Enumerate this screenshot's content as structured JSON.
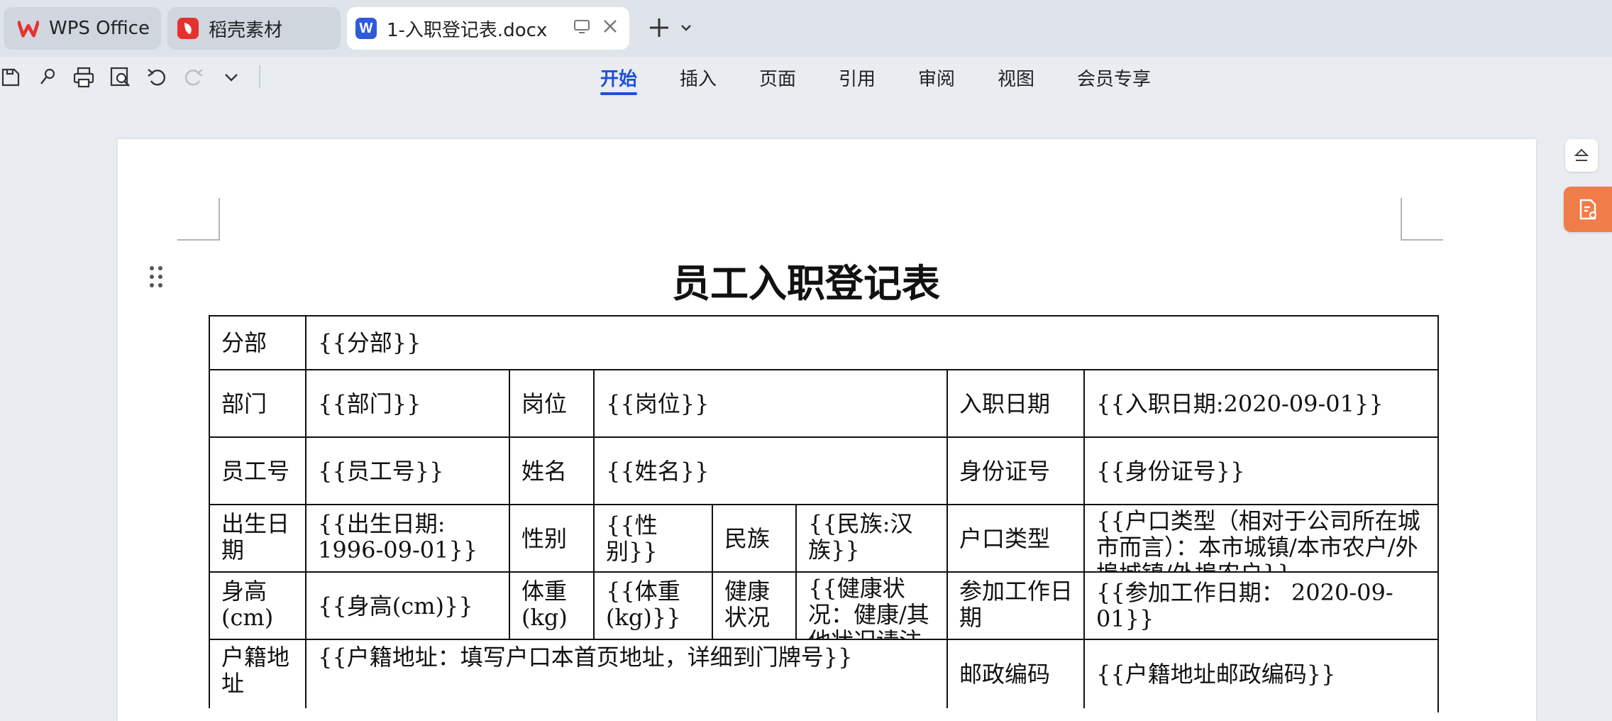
{
  "tabs": [
    {
      "label": "WPS Office"
    },
    {
      "label": "稻壳素材"
    },
    {
      "label": "1-入职登记表.docx"
    }
  ],
  "icons": {
    "wps": "wps-logo-icon",
    "docer": "docer-logo-icon",
    "word": "word-doc-icon",
    "plus": "plus-icon",
    "chevron": "chevron-down-icon"
  },
  "colors": {
    "accent": "#1f4fd6",
    "wps_red": "#e5322d",
    "word_blue": "#2f5bd8",
    "orange": "#f07c4a"
  },
  "menu": [
    "开始",
    "插入",
    "页面",
    "引用",
    "审阅",
    "视图",
    "会员专享"
  ],
  "document": {
    "title": "员工入职登记表",
    "rows": {
      "r1": {
        "c1": "分部",
        "c2": "{{分部}}"
      },
      "r2": {
        "c1": "部门",
        "c2": "{{部门}}",
        "c3": "岗位",
        "c4": "{{岗位}}",
        "c5": "入职日期",
        "c6": "{{入职日期:2020-09-01}}"
      },
      "r3": {
        "c1": "员工号",
        "c2": "{{员工号}}",
        "c3": "姓名",
        "c4": "{{姓名}}",
        "c5": "身份证号",
        "c6": "{{身份证号}}"
      },
      "r4": {
        "c1": "出生日期",
        "c2": "{{出生日期: 1996-09-01}}",
        "c3": "性别",
        "c4": "{{性别}}",
        "c5": "民族",
        "c6": "{{民族:汉族}}",
        "c7": "户口类型",
        "c8": "{{户口类型（相对于公司所在城市而言）：本市城镇/本市农户/外埠城镇/外埠农户}}"
      },
      "r5": {
        "c1": "身高(cm)",
        "c2": "{{身高(cm)}}",
        "c3": "体重(kg)",
        "c4": "{{体重(kg)}}",
        "c5": "健康状况",
        "c6": "{{健康状况：健康/其他状况请注明}}",
        "c7": "参加工作日期",
        "c8": "{{参加工作日期： 2020-09-01}}"
      },
      "r6": {
        "c1": "户籍地址",
        "c2": "{{户籍地址：填写户口本首页地址，详细到门牌号}}",
        "c3": "邮政编码",
        "c4": "{{户籍地址邮政编码}}"
      }
    }
  }
}
